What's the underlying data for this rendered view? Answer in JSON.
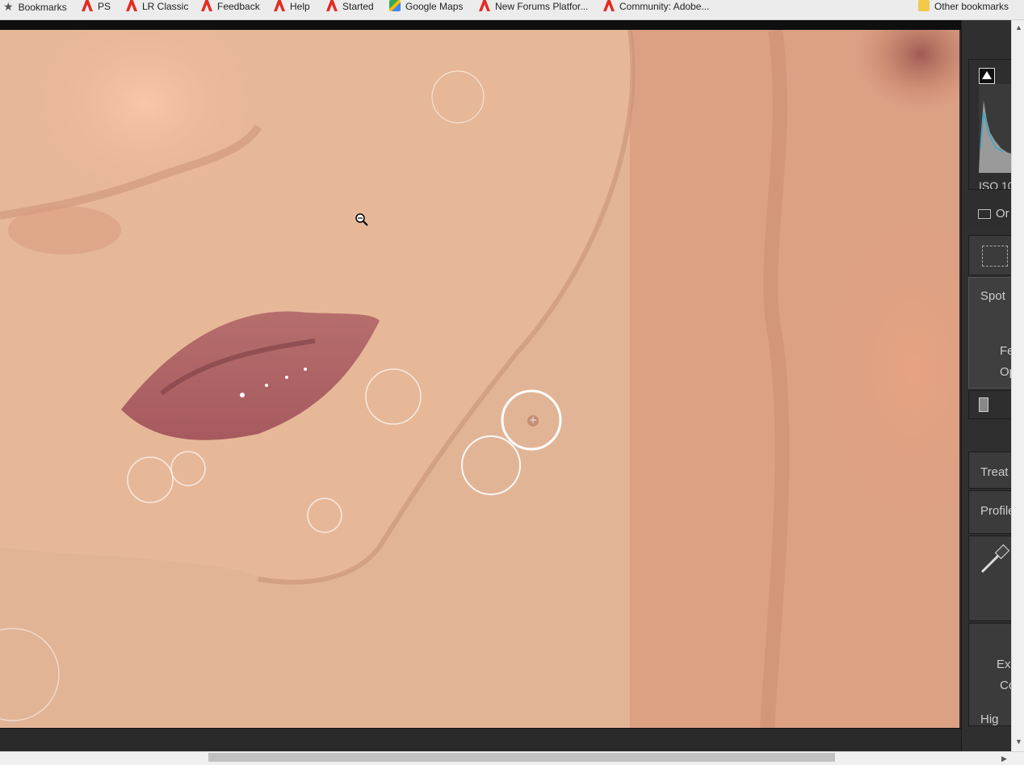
{
  "bookmarks_bar": {
    "items": [
      {
        "label": "Bookmarks",
        "icon": "star-icon"
      },
      {
        "label": "PS",
        "icon": "adobe-icon"
      },
      {
        "label": "LR Classic",
        "icon": "adobe-icon"
      },
      {
        "label": "Feedback",
        "icon": "adobe-icon"
      },
      {
        "label": "Help",
        "icon": "adobe-icon"
      },
      {
        "label": "Started",
        "icon": "adobe-icon"
      },
      {
        "label": "Google Maps",
        "icon": "maps-icon"
      },
      {
        "label": "New Forums Platfor...",
        "icon": "adobe-icon"
      },
      {
        "label": "Community: Adobe...",
        "icon": "adobe-icon"
      }
    ],
    "other": {
      "label": "Other bookmarks",
      "icon": "folder-icon"
    }
  },
  "right_panel": {
    "histogram_info": "ISO 10",
    "original_photo_label": "Or",
    "spot_label": "Spot",
    "feather_label": "Fea",
    "opacity_label": "Op",
    "treatment_label": "Treat",
    "profile_label": "Profile",
    "exposure_label": "Ex",
    "contrast_label": "Co",
    "highlights_label": "Hig"
  },
  "colors": {
    "skin": "#e0b394",
    "panel_bg": "#2f2f2f",
    "spot_circle": "#ffffff"
  }
}
